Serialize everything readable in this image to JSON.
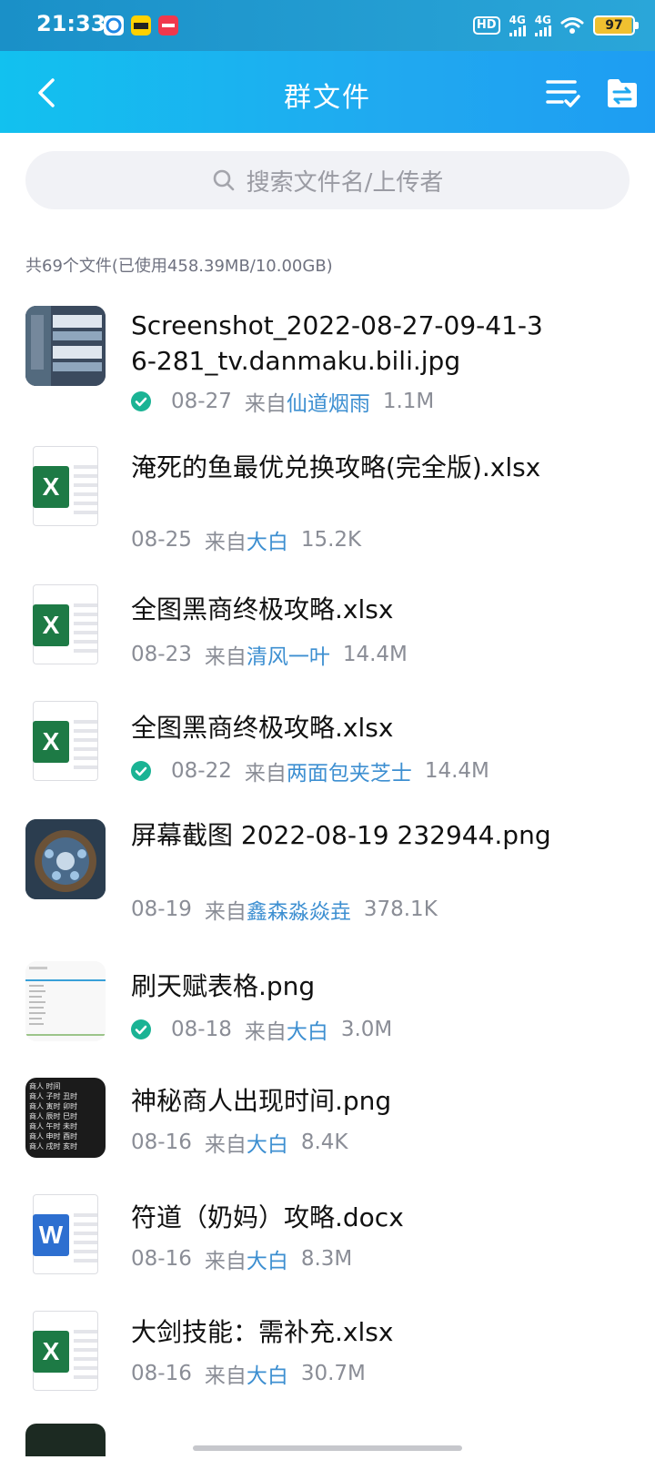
{
  "status_bar": {
    "time": "21:33",
    "network_hd": "HD",
    "network_a": "4G",
    "network_b": "4G",
    "battery": "97",
    "app_icons": [
      {
        "name": "browser-app-icon",
        "color": "#1e88e5"
      },
      {
        "name": "meituan-app-icon",
        "color": "#ffd100",
        "label": "美团"
      },
      {
        "name": "red-app-icon",
        "color": "#f0384d"
      }
    ]
  },
  "header": {
    "title": "群文件",
    "back_icon": "chevron-left-icon",
    "sort_icon": "multi-select-icon",
    "transfer_icon": "folder-transfer-icon"
  },
  "search": {
    "placeholder": "搜索文件名/上传者",
    "icon": "search-icon"
  },
  "summary": "共69个文件(已使用458.39MB/10.00GB)",
  "colors": {
    "accent": "#20a9f0",
    "uploader": "#3d8fd1",
    "check": "#1ab394",
    "excel": "#1d7a45",
    "word": "#2d6fd0"
  },
  "files": [
    {
      "name": "Screenshot_2022-08-27-09-41-36-281_tv.danmaku.bili.jpg",
      "date": "08-27",
      "from": "来自",
      "uploader": "仙道烟雨",
      "size": "1.1M",
      "downloaded": true,
      "type": "image-game-ui"
    },
    {
      "name": "淹死的鱼最优兑换攻略(完全版).xlsx",
      "date": "08-25",
      "from": "来自",
      "uploader": "大白",
      "size": "15.2K",
      "downloaded": false,
      "type": "excel"
    },
    {
      "name": "全图黑商终极攻略.xlsx",
      "date": "08-23",
      "from": "来自",
      "uploader": "清风一叶",
      "size": "14.4M",
      "downloaded": false,
      "type": "excel"
    },
    {
      "name": "全图黑商终极攻略.xlsx",
      "date": "08-22",
      "from": "来自",
      "uploader": "两面包夹芝士",
      "size": "14.4M",
      "downloaded": true,
      "type": "excel"
    },
    {
      "name": "屏幕截图 2022-08-19 232944.png",
      "date": "08-19",
      "from": "来自",
      "uploader": "鑫森淼焱垚",
      "size": "378.1K",
      "downloaded": false,
      "type": "image-game-map"
    },
    {
      "name": "刷天赋表格.png",
      "date": "08-18",
      "from": "来自",
      "uploader": "大白",
      "size": "3.0M",
      "downloaded": true,
      "type": "image-table"
    },
    {
      "name": "神秘商人出现时间.png",
      "date": "08-16",
      "from": "来自",
      "uploader": "大白",
      "size": "8.4K",
      "downloaded": false,
      "type": "image-dark-text"
    },
    {
      "name": "符道（奶妈）攻略.docx",
      "date": "08-16",
      "from": "来自",
      "uploader": "大白",
      "size": "8.3M",
      "downloaded": false,
      "type": "word"
    },
    {
      "name": "大剑技能：需补充.xlsx",
      "date": "08-16",
      "from": "来自",
      "uploader": "大白",
      "size": "30.7M",
      "downloaded": false,
      "type": "excel"
    }
  ],
  "thumb_text": {
    "excel_badge": "X",
    "word_badge": "W",
    "dark_text_lines": [
      "商人 时间",
      "商人 子时 丑时",
      "商人 寅时 卯时",
      "商人 辰时 巳时",
      "商人 午时 未时",
      "商人 申时 酉时",
      "商人 戌时 亥时"
    ]
  }
}
